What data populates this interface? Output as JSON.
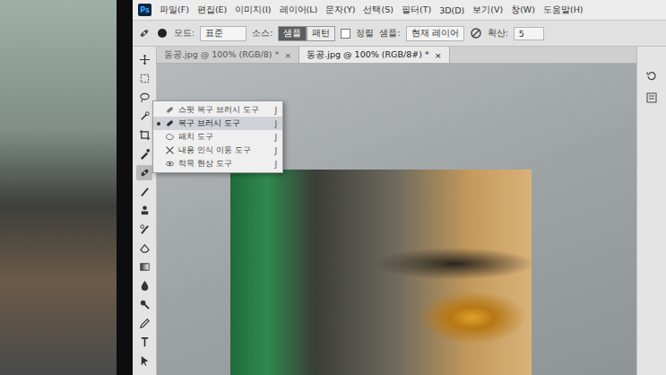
{
  "menu_bar": {
    "app_icon": "Ps",
    "items": [
      "파일(F)",
      "편집(E)",
      "이미지(I)",
      "레이어(L)",
      "문자(Y)",
      "선택(S)",
      "필터(T)",
      "3D(D)",
      "보기(V)",
      "창(W)",
      "도움말(H)"
    ]
  },
  "options_bar": {
    "mode_label": "모드:",
    "mode_value": "표준",
    "source_label": "소스:",
    "source_options": [
      {
        "label": "샘플",
        "selected": true
      },
      {
        "label": "패턴",
        "selected": false
      }
    ],
    "aligned": {
      "label": "정렬",
      "checked": false
    },
    "sample_label": "샘플:",
    "sample_value": "현재 레이어",
    "diffusion_label": "확산:",
    "diffusion_value": "5"
  },
  "tabs": [
    {
      "label": "동공.jpg @ 100% (RGB/8) *",
      "close": "×",
      "selected": false
    },
    {
      "label": "동공.jpg @ 100% (RGB/8#) *",
      "close": "×",
      "selected": true
    }
  ],
  "toolbar": {
    "tools": [
      {
        "selected": false
      },
      {
        "selected": false
      },
      {
        "selected": false
      },
      {
        "selected": false
      },
      {
        "selected": false
      },
      {
        "selected": false
      },
      {
        "selected": true
      },
      {
        "selected": false
      },
      {
        "selected": false
      },
      {
        "selected": false
      },
      {
        "selected": false
      },
      {
        "selected": false
      },
      {
        "selected": false
      },
      {
        "selected": false
      },
      {
        "selected": false
      },
      {
        "selected": false
      },
      {
        "selected": false
      }
    ]
  },
  "tool_flyout": {
    "items": [
      {
        "label": "스팟 복구 브러시 도구",
        "shortcut": "J",
        "selected": false
      },
      {
        "label": "복구 브러시 도구",
        "shortcut": "J",
        "selected": true
      },
      {
        "label": "패치 도구",
        "shortcut": "J",
        "selected": false
      },
      {
        "label": "내용 인식 이동 도구",
        "shortcut": "J",
        "selected": false
      },
      {
        "label": "적목 현상 도구",
        "shortcut": "J",
        "selected": false
      }
    ]
  }
}
